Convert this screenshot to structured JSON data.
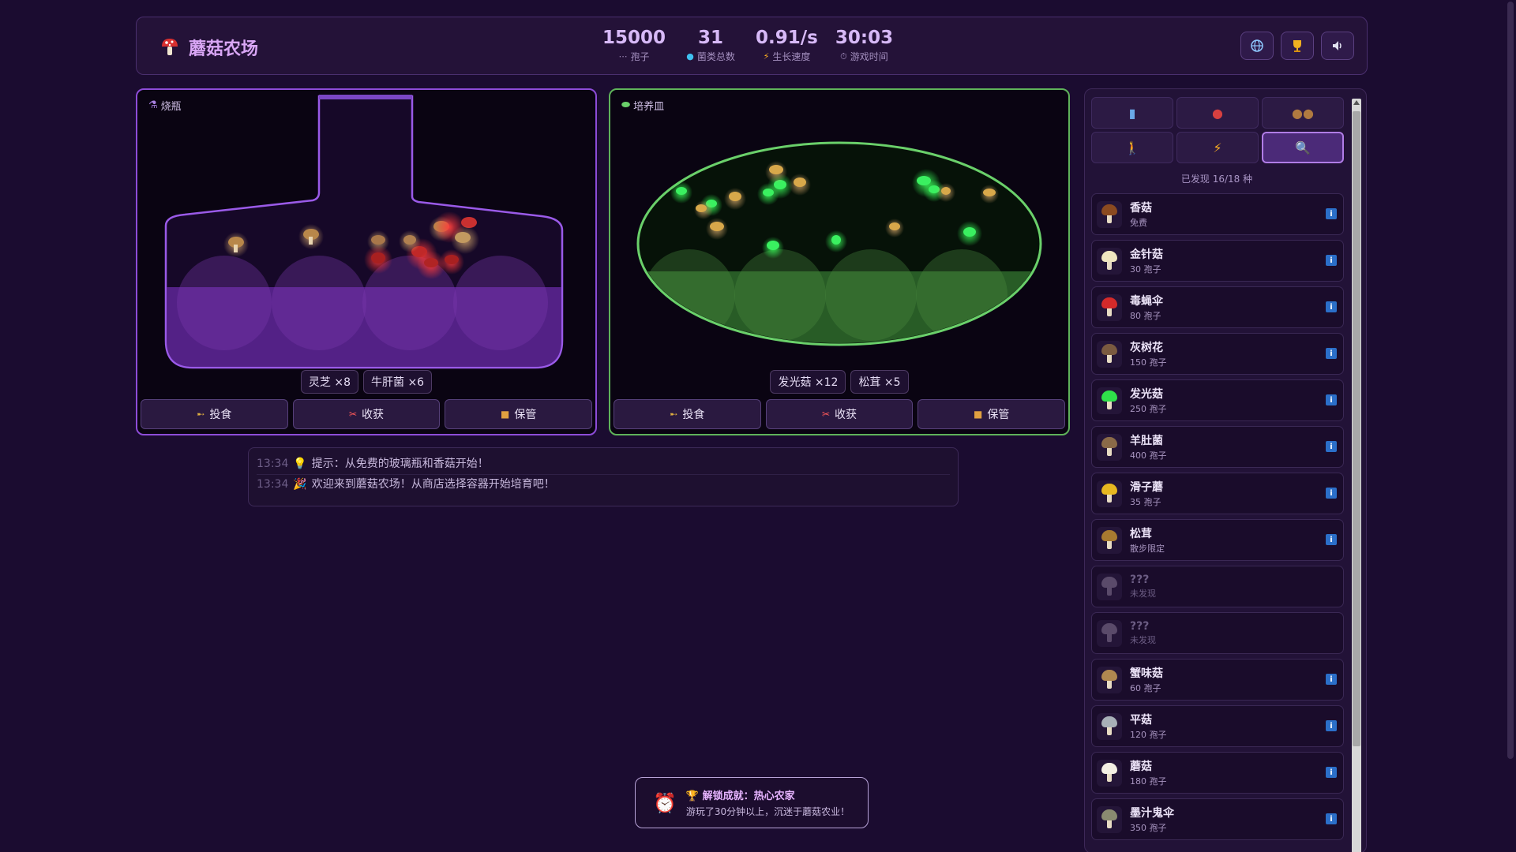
{
  "header": {
    "title": "蘑菇农场",
    "stats": [
      {
        "value": "15000",
        "label": "孢子",
        "icon": "spore-icon"
      },
      {
        "value": "31",
        "label": "菌类总数",
        "icon": "globe-icon"
      },
      {
        "value": "0.91/s",
        "label": "生长速度",
        "icon": "lightning-icon"
      },
      {
        "value": "30:03",
        "label": "游戏时间",
        "icon": "stopwatch-icon"
      }
    ],
    "buttons": [
      "globe-icon",
      "trophy-icon",
      "speaker-icon"
    ]
  },
  "containers": [
    {
      "label": "烧瓶",
      "icon": "flask-icon",
      "tags": [
        "灵芝 ×8",
        "牛肝菌 ×6"
      ],
      "actions": [
        "投食",
        "收获",
        "保管"
      ],
      "border_color": "#8d4cd8"
    },
    {
      "label": "培养皿",
      "icon": "petri-dish-icon",
      "tags": [
        "发光菇 ×12",
        "松茸 ×5"
      ],
      "actions": [
        "投食",
        "收获",
        "保管"
      ],
      "border_color": "#5fb35a"
    }
  ],
  "log": [
    {
      "time": "13:34",
      "icon": "lightbulb-icon",
      "text": "提示：从免费的玻璃瓶和香菇开始！"
    },
    {
      "time": "13:34",
      "icon": "party-icon",
      "text": "欢迎来到蘑菇农场！从商店选择容器开始培育吧！"
    }
  ],
  "toast": {
    "title": "🏆 解锁成就：热心农家",
    "desc": "游玩了30分钟以上，沉迷于蘑菇农业！"
  },
  "sidebar": {
    "categories": [
      "bottle-icon",
      "mushroom-icon",
      "coins-icon",
      "person-icon",
      "lightning-icon",
      "magnifier-icon"
    ],
    "active_category": 5,
    "discovered": "已发现 16/18 种",
    "items": [
      {
        "name": "香菇",
        "sub": "免费",
        "cap": "#8b4a20",
        "locked": false
      },
      {
        "name": "金针菇",
        "sub": "30 孢子",
        "cap": "#f0e6c0",
        "locked": false
      },
      {
        "name": "毒蝇伞",
        "sub": "80 孢子",
        "cap": "#d42a2a",
        "locked": false
      },
      {
        "name": "灰树花",
        "sub": "150 孢子",
        "cap": "#7a5a40",
        "locked": false
      },
      {
        "name": "发光菇",
        "sub": "250 孢子",
        "cap": "#2fe04a",
        "locked": false
      },
      {
        "name": "羊肚菌",
        "sub": "400 孢子",
        "cap": "#8a6a48",
        "locked": false
      },
      {
        "name": "滑子蘑",
        "sub": "35 孢子",
        "cap": "#e8b820",
        "locked": false
      },
      {
        "name": "松茸",
        "sub": "散步限定",
        "cap": "#a87a30",
        "locked": false
      },
      {
        "name": "???",
        "sub": "未发现",
        "cap": "#5a4a6a",
        "locked": true
      },
      {
        "name": "???",
        "sub": "未发现",
        "cap": "#5a4a6a",
        "locked": true
      },
      {
        "name": "蟹味菇",
        "sub": "60 孢子",
        "cap": "#b08850",
        "locked": false
      },
      {
        "name": "平菇",
        "sub": "120 孢子",
        "cap": "#a8b0b8",
        "locked": false
      },
      {
        "name": "蘑菇",
        "sub": "180 孢子",
        "cap": "#f4f0e4",
        "locked": false
      },
      {
        "name": "墨汁鬼伞",
        "sub": "350 孢子",
        "cap": "#8a8a70",
        "locked": false
      }
    ]
  }
}
